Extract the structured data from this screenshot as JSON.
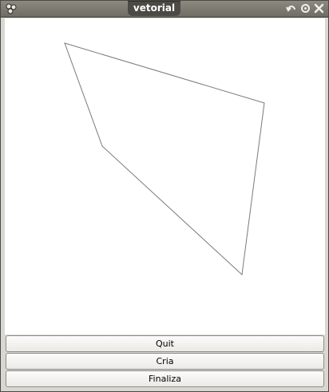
{
  "window": {
    "title": "vetorial"
  },
  "buttons": {
    "quit_label": "Quit",
    "cria_label": "Cria",
    "finaliza_label": "Finaliza"
  },
  "colors": {
    "titlebar": "#7c7a71",
    "title_tab": "#4b4a44",
    "canvas": "#ffffff",
    "polygon_stroke": "#777777"
  }
}
